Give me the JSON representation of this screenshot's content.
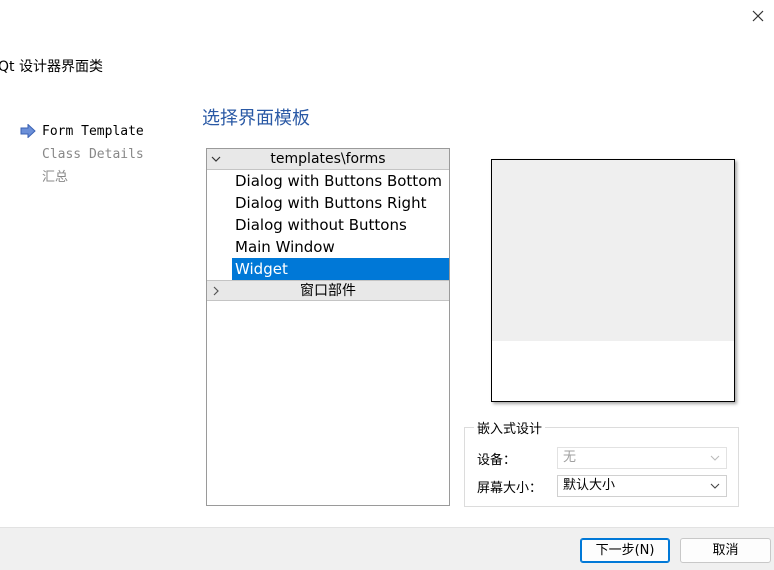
{
  "window": {
    "title": "Qt 设计器界面类",
    "close_icon": "close-icon"
  },
  "steps": [
    {
      "label": "Form Template",
      "state": "current"
    },
    {
      "label": "Class Details",
      "state": "pending"
    },
    {
      "label": "汇总",
      "state": "pending"
    }
  ],
  "page_title": "选择界面模板",
  "tree": {
    "groups": [
      {
        "label": "templates\\forms",
        "expanded": true,
        "items": [
          {
            "label": "Dialog with Buttons Bottom",
            "selected": false
          },
          {
            "label": "Dialog with Buttons Right",
            "selected": false
          },
          {
            "label": "Dialog without Buttons",
            "selected": false
          },
          {
            "label": "Main Window",
            "selected": false
          },
          {
            "label": "Widget",
            "selected": true
          }
        ]
      },
      {
        "label": "窗口部件",
        "expanded": false,
        "items": []
      }
    ]
  },
  "embedded_design": {
    "title": "嵌入式设计",
    "device_label": "设备：",
    "device_value": "无",
    "screen_size_label": "屏幕大小：",
    "screen_size_value": "默认大小"
  },
  "footer": {
    "next_label": "下一步(N)",
    "cancel_label": "取消"
  },
  "colors": {
    "accent": "#0078d7",
    "title_blue": "#2a59a5"
  }
}
